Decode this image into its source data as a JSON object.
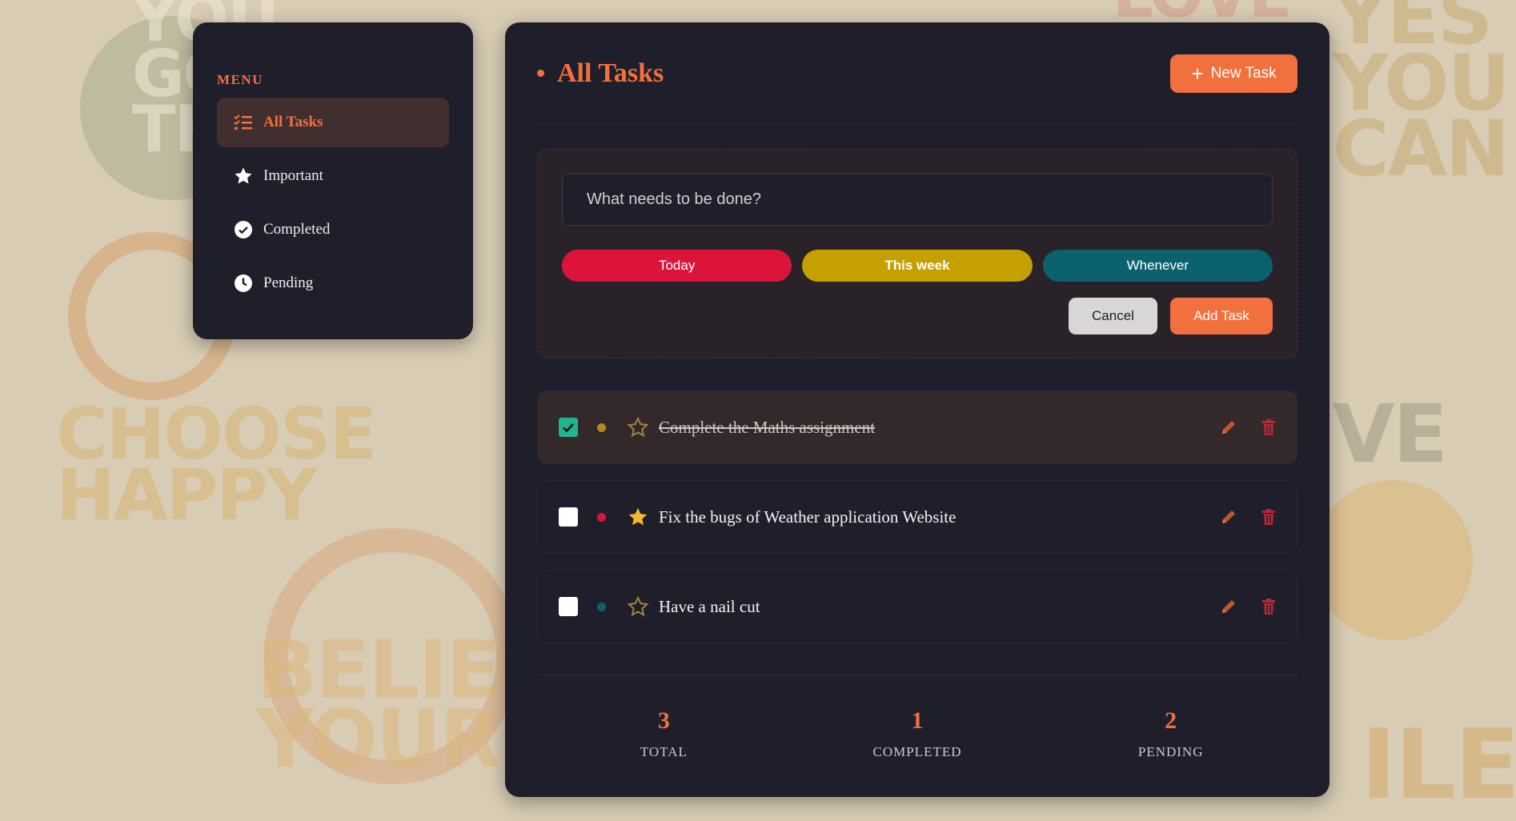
{
  "background": {
    "words": [
      "YOU GOT THIS",
      "YES YOU CAN",
      "CHOOSE HAPPY",
      "BELIEVE YOURSELF",
      "LOVE",
      "VE",
      "ILE"
    ]
  },
  "sidebar": {
    "title": "MENU",
    "items": [
      {
        "label": "All Tasks",
        "icon": "list-check-icon",
        "active": true
      },
      {
        "label": "Important",
        "icon": "star-icon",
        "active": false
      },
      {
        "label": "Completed",
        "icon": "check-circle-icon",
        "active": false
      },
      {
        "label": "Pending",
        "icon": "clock-icon",
        "active": false
      }
    ]
  },
  "header": {
    "title": "All Tasks",
    "new_task_label": "New Task"
  },
  "form": {
    "placeholder": "What needs to be done?",
    "priorities": [
      {
        "label": "Today",
        "color": "#dc143c"
      },
      {
        "label": "This week",
        "color": "#c4a000"
      },
      {
        "label": "Whenever",
        "color": "#0b616e"
      }
    ],
    "cancel_label": "Cancel",
    "add_label": "Add Task"
  },
  "tasks": [
    {
      "text": "Complete the Maths assignment",
      "completed": true,
      "important": false,
      "priority_color": "#b08a1e"
    },
    {
      "text": "Fix the bugs of Weather application Website",
      "completed": false,
      "important": true,
      "priority_color": "#dc143c"
    },
    {
      "text": "Have a nail cut",
      "completed": false,
      "important": false,
      "priority_color": "#0b616e"
    }
  ],
  "stats": [
    {
      "value": "3",
      "label": "TOTAL"
    },
    {
      "value": "1",
      "label": "COMPLETED"
    },
    {
      "value": "2",
      "label": "PENDING"
    }
  ],
  "colors": {
    "accent": "#f2703d",
    "panel": "#1e1f2a",
    "check": "#1fb58f",
    "star": "#f5b82e"
  }
}
